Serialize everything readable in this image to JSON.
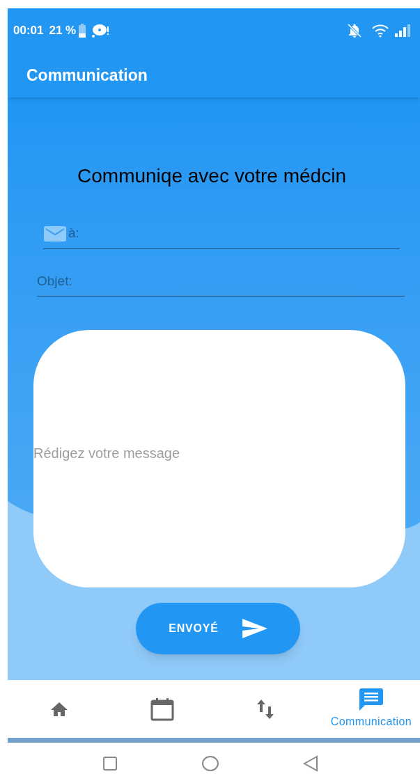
{
  "status_bar": {
    "time": "00:01",
    "battery": "21 %"
  },
  "app_bar": {
    "title": "Communication"
  },
  "heading": "Communiqe avec votre médcin",
  "fields": [
    {
      "placeholder": "à:"
    },
    {
      "placeholder": "Objet:"
    }
  ],
  "message": {
    "placeholder": "Rédigez votre message"
  },
  "send_button": {
    "label": "ENVOYÉ"
  },
  "bottom_nav": [
    {
      "selected": false
    },
    {
      "selected": false
    },
    {
      "selected": false
    },
    {
      "label": "Communication",
      "selected": true
    }
  ]
}
